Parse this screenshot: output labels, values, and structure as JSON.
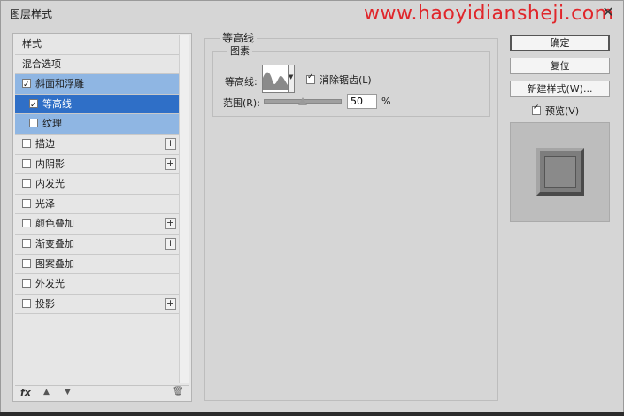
{
  "window": {
    "title": "图层样式",
    "watermark": "www.haoyidiansheji.com",
    "close_label": "✕"
  },
  "styles_list": {
    "header": "样式",
    "blend_options": "混合选项",
    "items": [
      {
        "label": "斜面和浮雕",
        "checked": true,
        "has_plus": false
      },
      {
        "label": "等高线",
        "checked": true,
        "has_plus": false
      },
      {
        "label": "纹理",
        "checked": false,
        "has_plus": false
      },
      {
        "label": "描边",
        "checked": false,
        "has_plus": true
      },
      {
        "label": "内阴影",
        "checked": false,
        "has_plus": true
      },
      {
        "label": "内发光",
        "checked": false,
        "has_plus": false
      },
      {
        "label": "光泽",
        "checked": false,
        "has_plus": false
      },
      {
        "label": "颜色叠加",
        "checked": false,
        "has_plus": true
      },
      {
        "label": "渐变叠加",
        "checked": false,
        "has_plus": true
      },
      {
        "label": "图案叠加",
        "checked": false,
        "has_plus": false
      },
      {
        "label": "外发光",
        "checked": false,
        "has_plus": false
      },
      {
        "label": "投影",
        "checked": false,
        "has_plus": true
      }
    ],
    "plus_glyph": "+",
    "bottom_fx": "fx",
    "bottom_up": "▲",
    "bottom_down": "▼",
    "bottom_trash": "🗑"
  },
  "contour_panel": {
    "group_title": "等高线",
    "subgroup_title": "图素",
    "contour_label": "等高线:",
    "antialias_label": "消除锯齿(L)",
    "antialias_checked": true,
    "range_label": "范围(R):",
    "range_value": "50",
    "range_unit": "%",
    "range_percent": 50,
    "dropdown_glyph": "▼"
  },
  "buttons": {
    "ok": "确定",
    "reset": "复位",
    "new_style": "新建样式(W)...",
    "preview_label": "预览(V)",
    "preview_checked": true
  },
  "colors": {
    "selection_light": "#8fb6e3",
    "selection_dark": "#2f6fc7",
    "watermark": "#e0262b"
  }
}
